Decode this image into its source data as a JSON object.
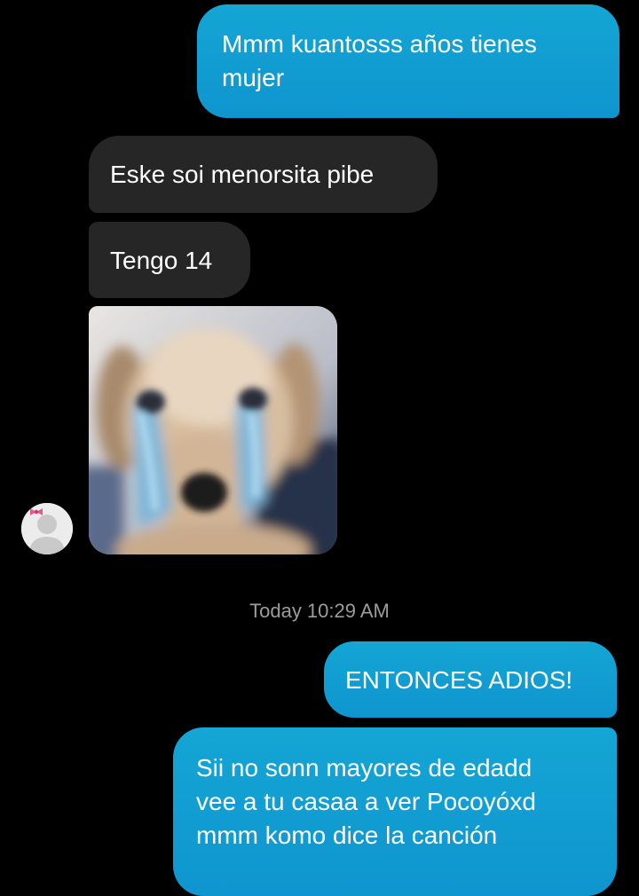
{
  "conversation": {
    "messages": [
      {
        "direction": "sent",
        "text": "Mmm kuantosss años tienes\nmujer"
      },
      {
        "direction": "received",
        "text": "Eske soi menorsita pibe"
      },
      {
        "direction": "received",
        "text": "Tengo 14"
      },
      {
        "direction": "received",
        "type": "image",
        "image": "crying-puppy-photo"
      },
      {
        "direction": "sent",
        "text": "ENTONCES ADIOS!"
      },
      {
        "direction": "sent",
        "text": "Sii no sonn mayores de edadd\nvee a tu casaa a ver Pocoyóxd\nmmm komo dice la canción"
      }
    ],
    "timestamp": "Today 10:29 AM"
  },
  "contact": {
    "avatar_icon": "default-profile-icon",
    "avatar_badge_icon": "pink-bow-icon"
  },
  "colors": {
    "background": "#000000",
    "sent_bubble": "#12a0d3",
    "received_bubble": "#262626",
    "timestamp_text": "#9c9c9c",
    "bow": "#e8578a"
  }
}
